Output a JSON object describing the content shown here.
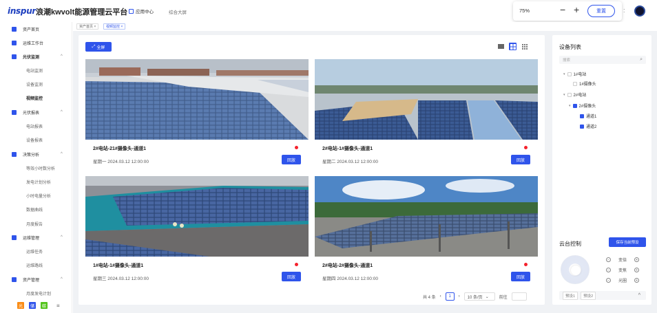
{
  "header": {
    "logo": "inspur",
    "brand": "浪潮kwvolt能源管理云平台",
    "app_center": "应用中心",
    "big_screen": "综合大屏",
    "zoom": "75%",
    "zoom_minus": "−",
    "zoom_plus": "+",
    "reset": "重置",
    "more": ":"
  },
  "sidebar": {
    "items": [
      {
        "label": "资产首页",
        "icon": "home-icon"
      },
      {
        "label": "运维工作台",
        "icon": "grid-icon"
      },
      {
        "label": "光伏监测",
        "icon": "sun-icon",
        "caret": "^"
      },
      {
        "label": "电站监测"
      },
      {
        "label": "设备监测"
      },
      {
        "label": "视频监控"
      },
      {
        "label": "光伏报表",
        "icon": "report-icon",
        "caret": "^"
      },
      {
        "label": "电站报表"
      },
      {
        "label": "设备报表"
      },
      {
        "label": "决策分析",
        "icon": "analysis-icon",
        "caret": "^"
      },
      {
        "label": "等效小时数分析"
      },
      {
        "label": "发电计划分析"
      },
      {
        "label": "小时电量分析"
      },
      {
        "label": "数据曲线"
      },
      {
        "label": "月度报告"
      },
      {
        "label": "运维管理",
        "icon": "tools-icon",
        "caret": "^"
      },
      {
        "label": "运维任务"
      },
      {
        "label": "运维路线"
      },
      {
        "label": "资产管理",
        "icon": "asset-icon",
        "caret": "^"
      },
      {
        "label": "月度发电计划"
      }
    ],
    "footer": {
      "b1": "光",
      "b2": "储",
      "b3": "碳",
      "menu": "≡"
    }
  },
  "tabs": [
    {
      "label": "资产首页 ×"
    },
    {
      "label": "视频监控 ×"
    }
  ],
  "main": {
    "fullscreen": "全屏",
    "cameras": [
      {
        "title": "2#电站-21#摄像头-通道1",
        "time": "星期一 2024.03.12 12:00:00",
        "back": "回放"
      },
      {
        "title": "2#电站-1#摄像头-通道1",
        "time": "星期二 2024.03.12 12:00:00",
        "back": "回放"
      },
      {
        "title": "1#电站-1#摄像头-通道1",
        "time": "星期三 2024.03.12 12:00:00",
        "back": "回放"
      },
      {
        "title": "2#电站-2#摄像头-通道1",
        "time": "星期四 2024.03.12 12:00:00",
        "back": "回放"
      }
    ],
    "pager": {
      "total": "共 4 条",
      "prev": "‹",
      "page": "1",
      "next": "›",
      "size": "10 条/页",
      "size_caret": "⌄",
      "goto": "前往"
    }
  },
  "right": {
    "title": "设备列表",
    "search_placeholder": "搜索",
    "search_icon": "⌕",
    "tree": [
      {
        "label": "1#电站"
      },
      {
        "label": "1#摄像头"
      },
      {
        "label": "2#电站"
      },
      {
        "label": "2#摄像头"
      },
      {
        "label": "通道1"
      },
      {
        "label": "通道2"
      }
    ],
    "ptz_title": "云台控制",
    "save_preset": "保存当前预设",
    "ptz": [
      {
        "label": "变倍"
      },
      {
        "label": "变焦"
      },
      {
        "label": "光圈"
      }
    ],
    "presets": [
      "预设1",
      "预设2"
    ],
    "presets_toggle": "^"
  },
  "colors": {
    "accent": "#2f54eb",
    "alarm": "#f5222d"
  }
}
